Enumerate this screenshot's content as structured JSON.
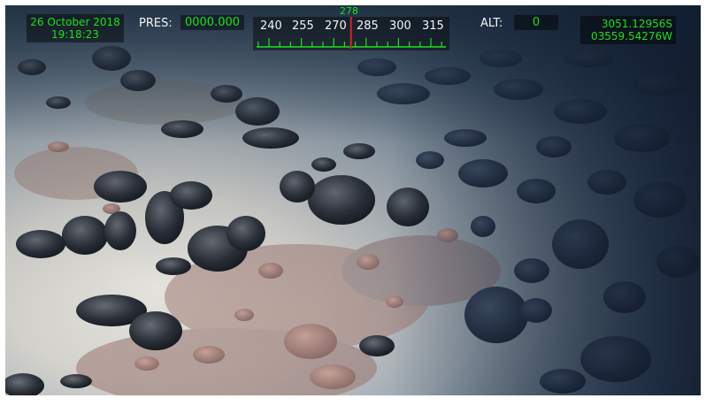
{
  "overlay": {
    "date": "26 October 2018",
    "time": "19:18:23",
    "pressure_label": "PRES:",
    "pressure_value": "0000.000",
    "heading_value": "278",
    "heading_scale": [
      "240",
      "255",
      "270",
      "285",
      "300",
      "315"
    ],
    "altitude_label": "ALT:",
    "altitude_value": "0",
    "latitude": "3051.12956S",
    "longitude": "03559.54276W"
  },
  "colors": {
    "hud_text": "#19e219",
    "hud_label": "#f1f4f4",
    "heading_marker": "#e02020"
  }
}
